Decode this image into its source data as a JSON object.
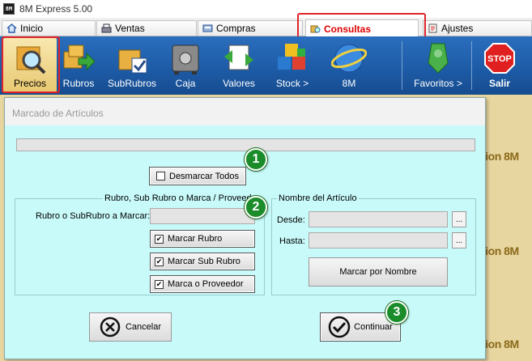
{
  "window": {
    "title": "8M Express 5.00",
    "icon_text": "8M"
  },
  "tabs": [
    {
      "label": "Inicio",
      "icon": "home-icon"
    },
    {
      "label": "Ventas",
      "icon": "cash-register-icon"
    },
    {
      "label": "Compras",
      "icon": "cart-icon"
    },
    {
      "label": "Consultas",
      "icon": "consultas-icon",
      "active": true
    },
    {
      "label": "Ajustes",
      "icon": "settings-icon"
    }
  ],
  "toolbar": {
    "buttons": [
      {
        "label": "Precios",
        "icon": "magnifier-box-icon",
        "active": true
      },
      {
        "label": "Rubros",
        "icon": "boxes-arrow-icon"
      },
      {
        "label": "SubRubros",
        "icon": "box-check-icon"
      },
      {
        "label": "Caja",
        "icon": "safe-icon"
      },
      {
        "label": "Valores",
        "icon": "document-arrows-icon"
      },
      {
        "label": "Stock >",
        "icon": "cubes-icon"
      },
      {
        "label": "8M",
        "icon": "globe-icon"
      },
      {
        "label": "Favoritos >",
        "icon": "ribbon-icon"
      },
      {
        "label": "Salir",
        "icon": "stop-icon",
        "badge": "STOP"
      }
    ]
  },
  "background_text": [
    "cion 8M",
    "cion 8M",
    "cion 8M"
  ],
  "dialog": {
    "title": "Marcado de Artículos",
    "desmarcar_label": "Desmarcar Todos",
    "rubro_group": {
      "title": "Rubro, Sub Rubro o Marca / Proveedor",
      "field_label": "Rubro o SubRubro a Marcar:",
      "checks": [
        {
          "label": "Marcar Rubro",
          "checked": true
        },
        {
          "label": "Marcar Sub Rubro",
          "checked": true
        },
        {
          "label": "Marca o Proveedor",
          "checked": true
        }
      ]
    },
    "nombre_group": {
      "title": "Nombre del Artículo",
      "desde_label": "Desde:",
      "hasta_label": "Hasta:",
      "ellipsis": "...",
      "marcar_nombre_label": "Marcar por Nombre"
    },
    "cancelar_label": "Cancelar",
    "continuar_label": "Continuar"
  },
  "callouts": [
    "1",
    "2",
    "3"
  ],
  "colors": {
    "toolbar_bg": "#1d5aa5",
    "dialog_bg": "#c8fafa",
    "highlight": "#e0232a",
    "callout": "#1a8c2a",
    "active_tab_text": "#dd0000"
  }
}
